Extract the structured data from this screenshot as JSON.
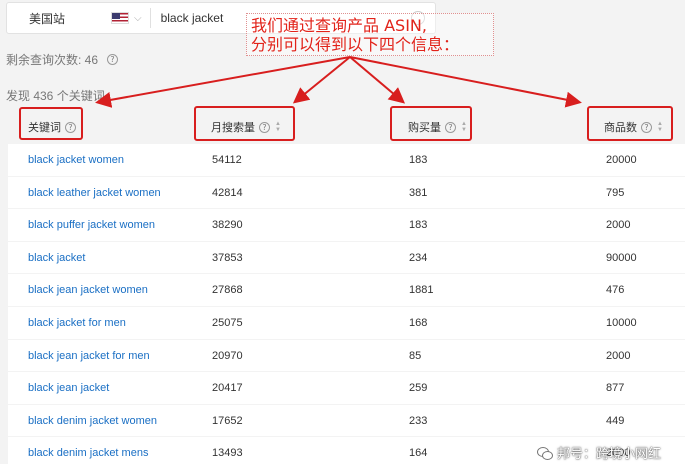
{
  "search": {
    "region": "美国站",
    "query": "black jacket"
  },
  "remaining_label": "剩余查询次数: 46",
  "found_label": "发现 436 个关键词",
  "columns": {
    "keyword": "关键词",
    "monthly_search": "月搜索量",
    "purchases": "购买量",
    "products": "商品数"
  },
  "rows": [
    {
      "keyword": "black jacket women",
      "monthly_search": "54112",
      "purchases": "183",
      "products": "20000"
    },
    {
      "keyword": "black leather jacket women",
      "monthly_search": "42814",
      "purchases": "381",
      "products": "795"
    },
    {
      "keyword": "black puffer jacket women",
      "monthly_search": "38290",
      "purchases": "183",
      "products": "2000"
    },
    {
      "keyword": "black jacket",
      "monthly_search": "37853",
      "purchases": "234",
      "products": "90000"
    },
    {
      "keyword": "black jean jacket women",
      "monthly_search": "27868",
      "purchases": "1881",
      "products": "476"
    },
    {
      "keyword": "black jacket for men",
      "monthly_search": "25075",
      "purchases": "168",
      "products": "10000"
    },
    {
      "keyword": "black jean jacket for men",
      "monthly_search": "20970",
      "purchases": "85",
      "products": "2000"
    },
    {
      "keyword": "black jean jacket",
      "monthly_search": "20417",
      "purchases": "259",
      "products": "877"
    },
    {
      "keyword": "black denim jacket women",
      "monthly_search": "17652",
      "purchases": "233",
      "products": "449"
    },
    {
      "keyword": "black denim jacket mens",
      "monthly_search": "13493",
      "purchases": "164",
      "products": "2000"
    }
  ],
  "annotation": {
    "line1": "我们通过查询产品 ASIN,",
    "line2": "分别可以得到以下四个信息："
  },
  "watermark": "邦号：跨境小网红",
  "accent_color": "#d81e1e",
  "link_color": "#1a6fc4"
}
